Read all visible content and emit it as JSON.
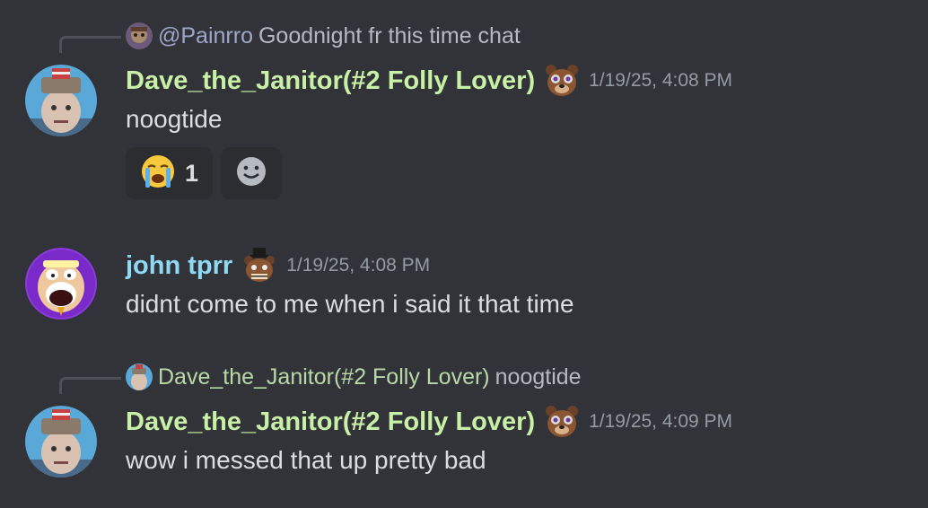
{
  "messages": [
    {
      "reply": {
        "mention": "@Painrro",
        "text": "Goodnight fr this time chat"
      },
      "author": "Dave_the_Janitor(#2 Folly Lover)",
      "timestamp": "1/19/25, 4:08 PM",
      "content": "noogtide",
      "reactions": [
        {
          "emoji": "loudly-crying-face",
          "count": "1"
        }
      ],
      "add_reaction_icon": "add-reaction-smiley-icon"
    },
    {
      "author": "john tprr",
      "timestamp": "1/19/25, 4:08 PM",
      "content": "didnt come to me when i said it that time"
    },
    {
      "reply": {
        "author": "Dave_the_Janitor(#2 Folly Lover)",
        "text": "noogtide"
      },
      "author": "Dave_the_Janitor(#2 Folly Lover)",
      "timestamp": "1/19/25, 4:09 PM",
      "content": "wow i messed that up pretty bad"
    }
  ],
  "colors": {
    "background": "#313338",
    "dave_name": "#c8f0a6",
    "john_name": "#8fd9f5",
    "timestamp": "#949ba4",
    "text": "#dbdee1"
  }
}
